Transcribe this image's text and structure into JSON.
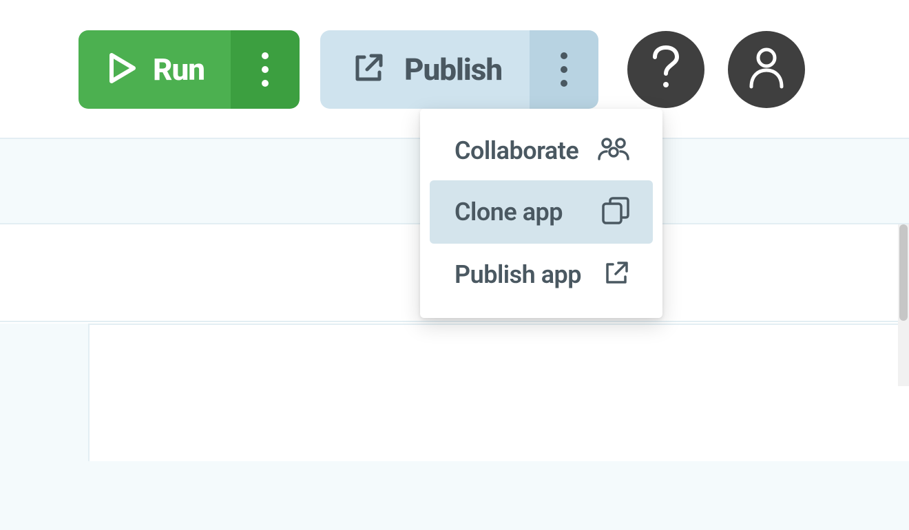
{
  "toolbar": {
    "run_label": "Run",
    "publish_label": "Publish"
  },
  "dropdown": {
    "items": [
      {
        "label": "Collaborate",
        "icon": "people-icon",
        "hover": false
      },
      {
        "label": "Clone app",
        "icon": "copy-icon",
        "hover": true
      },
      {
        "label": "Publish app",
        "icon": "external-link-icon",
        "hover": false
      }
    ]
  }
}
